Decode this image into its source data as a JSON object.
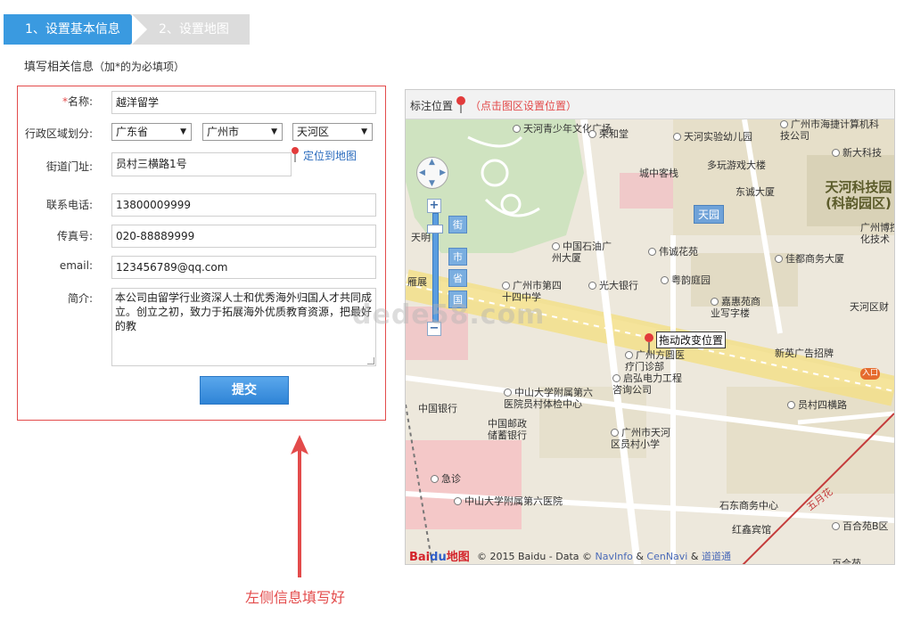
{
  "steps": {
    "active": "1、设置基本信息",
    "inactive": "2、设置地图"
  },
  "form": {
    "title": "填写相关信息",
    "note": "（加*的为必填项）",
    "name_label": "名称:",
    "name_required_mark": "*",
    "name_value": "越洋留学",
    "region_label": "行政区域划分:",
    "province": "广东省",
    "city": "广州市",
    "district": "天河区",
    "street_label": "街道门址:",
    "street_value": "员村三横路1号",
    "locate_link": "定位到地图",
    "phone_label": "联系电话:",
    "phone_value": "13800009999",
    "fax_label": "传真号:",
    "fax_value": "020-88889999",
    "email_label": "email:",
    "email_value": "123456789@qq.com",
    "intro_label": "简介:",
    "intro_value": "本公司由留学行业资深人士和优秀海外归国人才共同成立。创立之初，致力于拓展海外优质教育资源，把最好的教",
    "submit_label": "提交"
  },
  "annotation": "左侧信息填写好",
  "watermark": "dede58.com",
  "map": {
    "header_title": "标注位置",
    "header_hint": "（点击图区设置位置）",
    "drag_label": "拖动改变位置",
    "zoom_levels": [
      "街",
      "市",
      "省",
      "国"
    ],
    "labels": [
      "天河青少年文化广场",
      "荣和堂",
      "天河实验幼儿园",
      "广州市海捷计算机科技公司",
      "新大科技",
      "城中客栈",
      "多玩游戏大楼",
      "东诚大厦",
      "天河科技园(科韵园区)",
      "天园",
      "广州博控化技术",
      "天明",
      "中国石油广州大厦",
      "伟诚花苑",
      "佳都商务大厦",
      "雁展",
      "广州市第四十四中学",
      "光大银行",
      "粤韵庭园",
      "嘉惠苑商业写字楼",
      "天河区财",
      "广州方圆医疗门诊部",
      "新英广告招牌",
      "入口",
      "启弘电力工程咨询公司",
      "中国银行",
      "中山大学附属第六医院员村体检中心",
      "员村四横路",
      "中国邮政储蓄银行",
      "广州市天河区员村小学",
      "急诊",
      "中山大学附属第六医院",
      "石东商务中心",
      "百合苑B区",
      "红鑫宾馆",
      "五月花",
      "百合苑"
    ],
    "copyright_prefix": "© 2015 Baidu - Data ©",
    "copyright_navinfo": "NavInfo",
    "copyright_amp1": "&",
    "copyright_cennavi": "CenNavi",
    "copyright_amp2": "&",
    "copyright_daodao": "道道通",
    "logo_bai": "Bai",
    "logo_du": "du",
    "logo_ditu": "地图"
  },
  "colors": {
    "step_active": "#3a9ae0",
    "form_border": "#e34b4b",
    "submit": "#2f84d6",
    "annotation": "#e34b4b"
  }
}
